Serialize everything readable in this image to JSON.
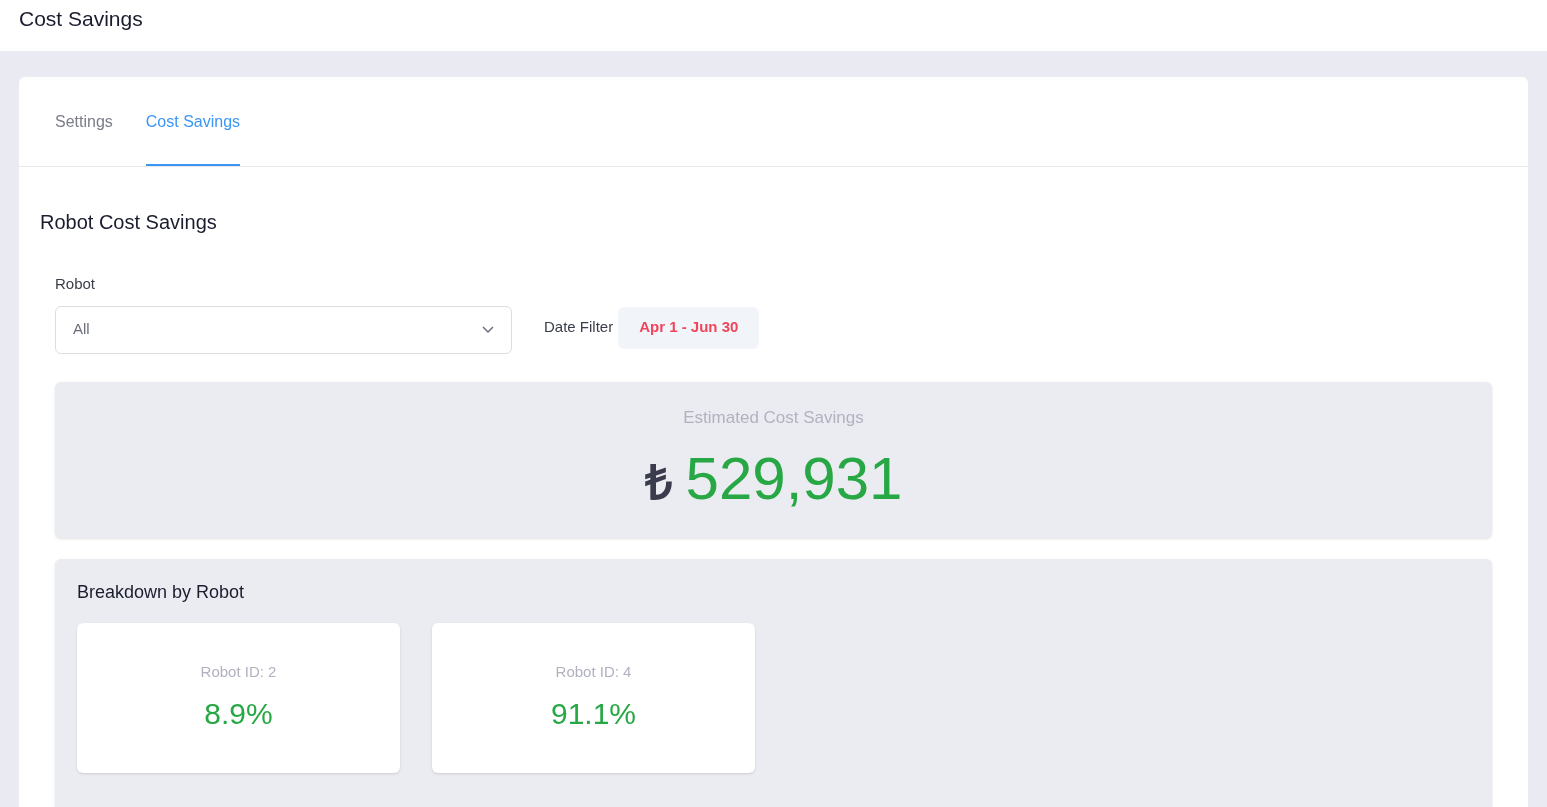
{
  "header": {
    "title": "Cost Savings"
  },
  "tabs": [
    {
      "label": "Settings",
      "selected": false
    },
    {
      "label": "Cost Savings",
      "selected": true
    }
  ],
  "section": {
    "title": "Robot Cost Savings"
  },
  "robot_filter": {
    "label": "Robot",
    "value": "All"
  },
  "date_filter": {
    "label": "Date Filter",
    "value": "Apr 1 - Jun 30"
  },
  "estimate": {
    "label": "Estimated Cost Savings",
    "currency_symbol": "₺",
    "amount": "529,931"
  },
  "breakdown": {
    "title": "Breakdown by Robot",
    "robots": [
      {
        "label": "Robot ID: 2",
        "share": "8.9%"
      },
      {
        "label": "Robot ID: 4",
        "share": "91.1%"
      }
    ]
  }
}
